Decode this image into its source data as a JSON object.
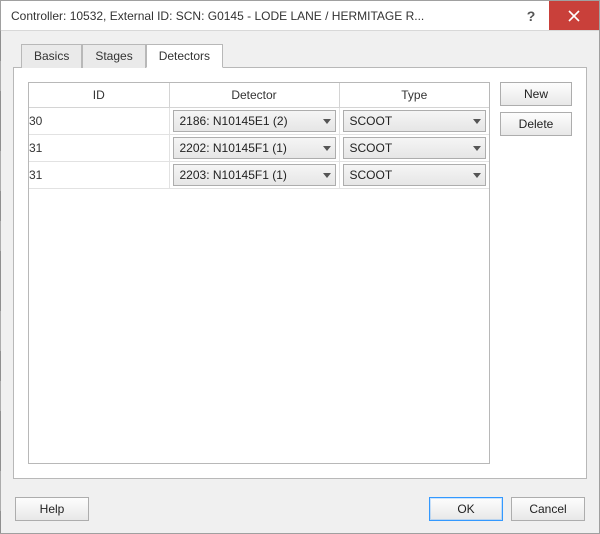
{
  "window": {
    "title": "Controller: 10532, External ID: SCN: G0145 - LODE LANE / HERMITAGE R..."
  },
  "tabs": [
    {
      "label": "Basics",
      "active": false
    },
    {
      "label": "Stages",
      "active": false
    },
    {
      "label": "Detectors",
      "active": true
    }
  ],
  "grid": {
    "columns": [
      "ID",
      "Detector",
      "Type"
    ],
    "rows": [
      {
        "id": "30",
        "detector": "2186: N10145E1 (2)",
        "type": "SCOOT"
      },
      {
        "id": "31",
        "detector": "2202: N10145F1 (1)",
        "type": "SCOOT"
      },
      {
        "id": "31",
        "detector": "2203: N10145F1 (1)",
        "type": "SCOOT"
      }
    ]
  },
  "side": {
    "new": "New",
    "delete": "Delete"
  },
  "footer": {
    "help": "Help",
    "ok": "OK",
    "cancel": "Cancel"
  }
}
